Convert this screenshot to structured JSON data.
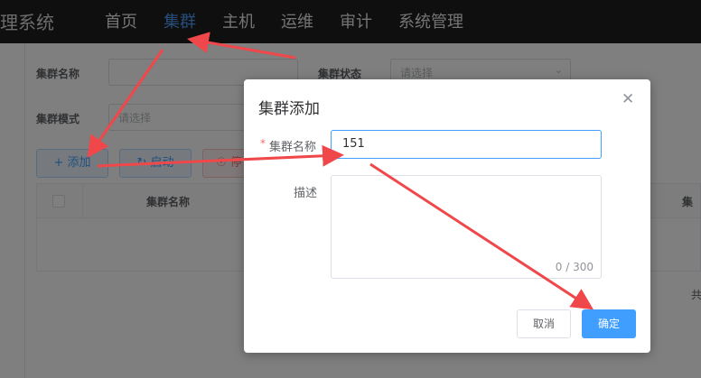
{
  "header": {
    "brand": "理系统",
    "nav": [
      "首页",
      "集群",
      "主机",
      "运维",
      "审计",
      "系统管理"
    ],
    "active_index": 1
  },
  "filters": {
    "cluster_name_label": "集群名称",
    "cluster_status_label": "集群状态",
    "cluster_status_placeholder": "请选择",
    "cluster_mode_label": "集群模式",
    "cluster_mode_placeholder": "请选择"
  },
  "toolbar": {
    "add_label": "添加",
    "start_label": "启动",
    "stop_label": "停"
  },
  "table": {
    "columns": [
      "集群名称",
      "集"
    ]
  },
  "pagination": {
    "total_prefix": "共"
  },
  "dialog": {
    "title": "集群添加",
    "name_label": "集群名称",
    "name_value": "151",
    "desc_label": "描述",
    "desc_counter": "0 / 300",
    "cancel_label": "取消",
    "ok_label": "确定"
  },
  "colors": {
    "primary": "#409eff",
    "danger": "#f56c6c",
    "annotation": "#f0474a",
    "nav_active": "#4e9bf5"
  },
  "icons": {
    "close": "close-icon",
    "add": "plus-icon",
    "start": "refresh-icon",
    "select": "chevron-down-icon"
  }
}
